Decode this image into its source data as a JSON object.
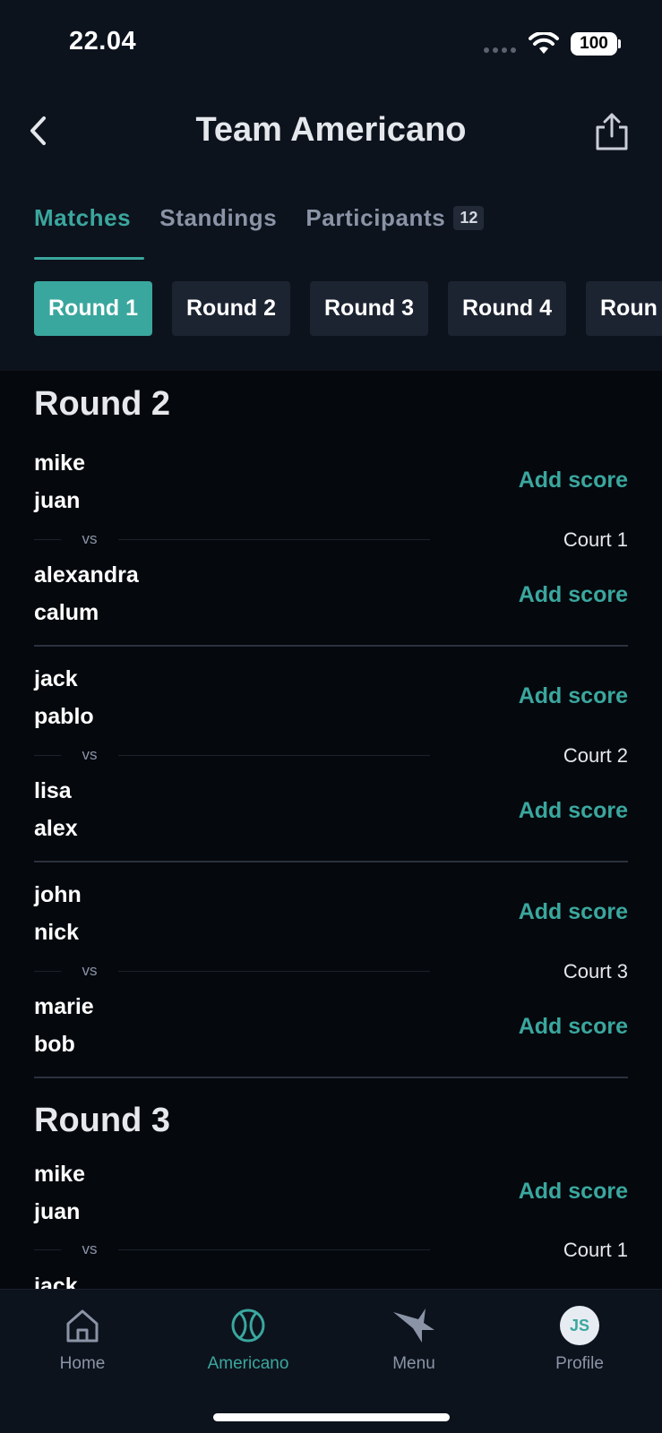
{
  "status_bar": {
    "time": "22.04",
    "battery": "100"
  },
  "header": {
    "title": "Team Americano"
  },
  "tabs": [
    {
      "label": "Matches"
    },
    {
      "label": "Standings"
    },
    {
      "label": "Participants",
      "badge": "12"
    }
  ],
  "round_chips": [
    "Round 1",
    "Round 2",
    "Round 3",
    "Round 4",
    "Roun"
  ],
  "add_score_label": "Add score",
  "vs_label": "vs",
  "rounds": [
    {
      "title": "Round 2",
      "matches": [
        {
          "court": "Court 1",
          "team_a": [
            "mike",
            "juan"
          ],
          "team_b": [
            "alexandra",
            "calum"
          ]
        },
        {
          "court": "Court 2",
          "team_a": [
            "jack",
            "pablo"
          ],
          "team_b": [
            "lisa",
            "alex"
          ]
        },
        {
          "court": "Court 3",
          "team_a": [
            "john",
            "nick"
          ],
          "team_b": [
            "marie",
            "bob"
          ]
        }
      ]
    },
    {
      "title": "Round 3",
      "matches": [
        {
          "court": "Court 1",
          "team_a": [
            "mike",
            "juan"
          ],
          "team_b": [
            "jack"
          ]
        }
      ]
    }
  ],
  "bottom_nav": [
    {
      "label": "Home",
      "icon": "home-icon"
    },
    {
      "label": "Americano",
      "icon": "tennis-ball-icon"
    },
    {
      "label": "Menu",
      "icon": "star-icon"
    },
    {
      "label": "Profile",
      "icon": "avatar",
      "initials": "JS"
    }
  ]
}
